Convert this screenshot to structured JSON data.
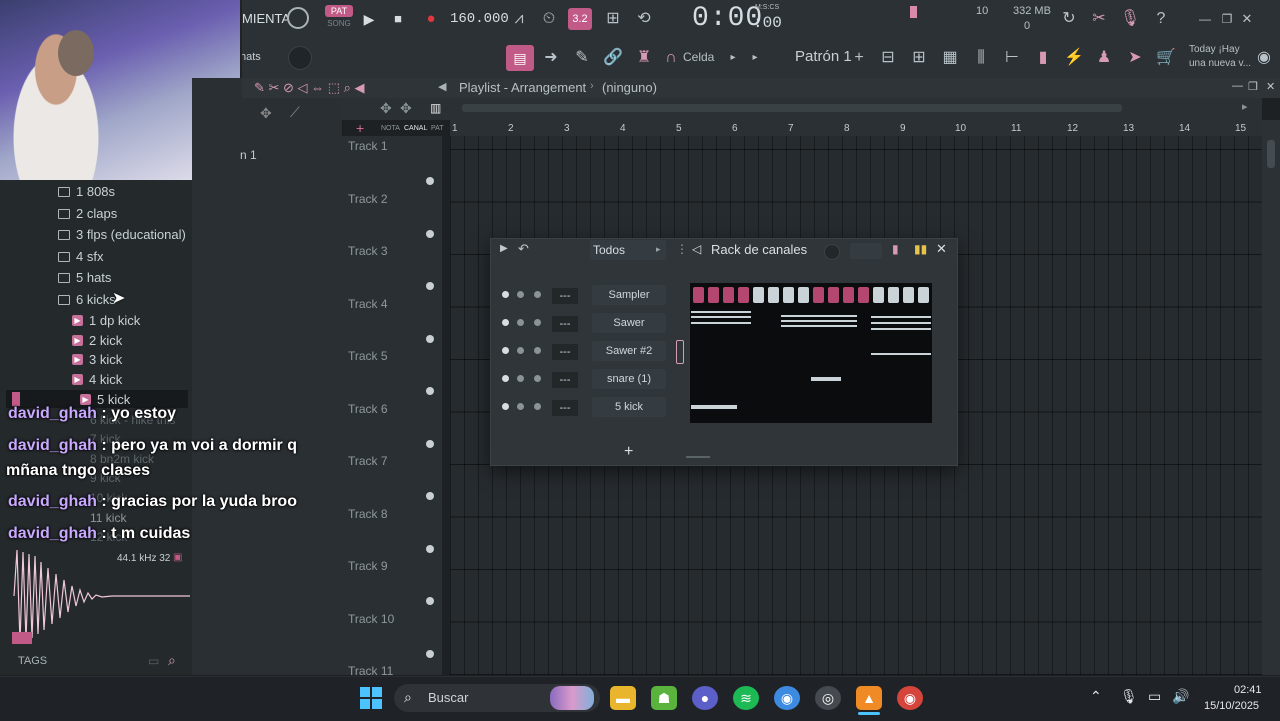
{
  "toolbar": {
    "app_menu_label": "MIENTA",
    "pat_label": "PAT",
    "song_label": "SONG",
    "tempo": "160.000",
    "time_display": "0:00",
    "time_sub": ":00",
    "time_unit": "M:S:CS",
    "cpu_value": "10",
    "mem_value": "332 MB",
    "mem_sub": "0",
    "snap_label": "Celda",
    "pattern_label": "Patrón 1",
    "news_line1": "Today ¡Hay",
    "news_line2": "una nueva v...",
    "hats_label": "hats"
  },
  "playlist": {
    "title": "Playlist - Arrangement",
    "subtitle": "(ninguno)",
    "tabs": [
      "NOTA",
      "CANAL",
      "PAT"
    ],
    "ruler": [
      "1",
      "2",
      "3",
      "4",
      "5",
      "6",
      "7",
      "8",
      "9",
      "10",
      "11",
      "12",
      "13",
      "14",
      "15"
    ],
    "tracks": [
      "Track 1",
      "Track 2",
      "Track 3",
      "Track 4",
      "Track 5",
      "Track 6",
      "Track 7",
      "Track 8",
      "Track 9",
      "Track 10",
      "Track 11"
    ],
    "mini_label": "n 1"
  },
  "browser": {
    "folders": [
      "1 808s",
      "2 claps",
      "3 flps (educational)",
      "4 sfx",
      "5 hats",
      "6 kicks"
    ],
    "files": [
      "1 dp kick",
      "2 kick",
      "3 kick",
      "4 kick",
      "5 kick"
    ],
    "hidden_files": [
      "6 kick - hike this",
      "7 kick",
      "8 bn2m kick",
      "9 kick",
      "10 kick",
      "11 kick",
      "12 kick"
    ],
    "sample_info": "44.1 kHz 32",
    "tags_label": "TAGS"
  },
  "chat": [
    {
      "user": "david_ghah",
      "message": ": yo estoy"
    },
    {
      "user": "david_ghah",
      "message": ": pero ya m voi a dormir q"
    },
    {
      "user": "",
      "message": "mñana tngo clases"
    },
    {
      "user": "david_ghah",
      "message": ": gracias por la yuda broo"
    },
    {
      "user": "david_ghah",
      "message": ": t m cuidas"
    }
  ],
  "rack": {
    "filter_label": "Todos",
    "title": "Rack de canales",
    "channels": [
      {
        "name": "Sampler",
        "mixer": "---"
      },
      {
        "name": "Sawer",
        "mixer": "---"
      },
      {
        "name": "Sawer #2",
        "mixer": "---"
      },
      {
        "name": "snare (1)",
        "mixer": "---"
      },
      {
        "name": "5 kick",
        "mixer": "---"
      }
    ],
    "add_label": "+"
  },
  "taskbar": {
    "search_placeholder": "Buscar",
    "time": "02:41",
    "date": "15/10/2025"
  },
  "colors": {
    "accent_pink": "#c25a87",
    "step_light": "#c9d3d8",
    "rec_red": "#e0383c"
  }
}
